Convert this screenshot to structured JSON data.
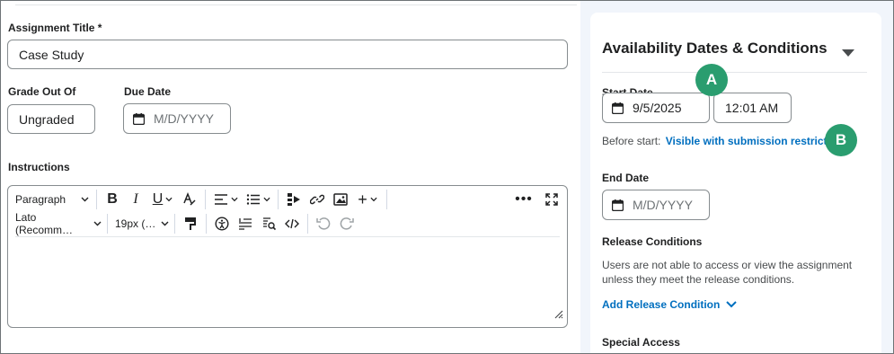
{
  "assignment": {
    "title_label": "Assignment Title *",
    "title_value": "Case Study",
    "grade_label": "Grade Out Of",
    "grade_value": "Ungraded",
    "due_label": "Due Date",
    "due_placeholder": "M/D/YYYY",
    "instructions_label": "Instructions"
  },
  "editor": {
    "format_label": "Paragraph",
    "font_label": "Lato (Recomm…",
    "size_label": "19px (…"
  },
  "availability": {
    "title": "Availability Dates & Conditions",
    "start_label": "Start Date",
    "start_date": "9/5/2025",
    "start_time": "12:01 AM",
    "before_start_label": "Before start:",
    "before_start_link": "Visible with submission restricted",
    "end_label": "End Date",
    "end_placeholder": "M/D/YYYY",
    "release_title": "Release Conditions",
    "release_desc_1": "Users are not able to access or view the assignment",
    "release_desc_2": "unless they meet the release conditions.",
    "add_release_link": "Add Release Condition",
    "special_access_title": "Special Access"
  },
  "callouts": {
    "a": "A",
    "b": "B"
  },
  "colors": {
    "accent_link": "#006fbf",
    "badge": "#2a9d6f",
    "sidebar_bg": "#f1f5fb"
  }
}
